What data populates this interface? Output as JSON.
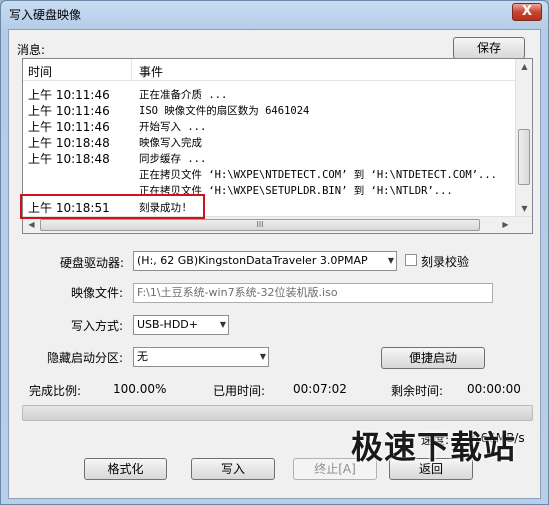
{
  "window": {
    "title": "写入硬盘映像",
    "close": "X"
  },
  "message_label": "消息:",
  "save_button": "保存",
  "log": {
    "columns": [
      "时间",
      "事件"
    ],
    "rows": [
      {
        "time": "上午  10:11:46",
        "event": "正在准备介质 ..."
      },
      {
        "time": "上午  10:11:46",
        "event": "ISO 映像文件的扇区数为 6461024"
      },
      {
        "time": "上午  10:11:46",
        "event": "开始写入 ..."
      },
      {
        "time": "上午  10:18:48",
        "event": "映像写入完成"
      },
      {
        "time": "上午  10:18:48",
        "event": "同步缓存 ..."
      },
      {
        "time": "",
        "event": "正在拷贝文件 ‘H:\\WXPE\\NTDETECT.COM’ 到 ‘H:\\NTDETECT.COM’..."
      },
      {
        "time": "",
        "event": "正在拷贝文件 ‘H:\\WXPE\\SETUPLDR.BIN’ 到 ‘H:\\NTLDR’..."
      },
      {
        "time": "上午  10:18:51",
        "event": "刻录成功!"
      }
    ],
    "hscroll_grip": "III"
  },
  "drive": {
    "label": "硬盘驱动器:",
    "value": "(H:, 62 GB)KingstonDataTraveler 3.0PMAP"
  },
  "verify": {
    "label": "刻录校验",
    "checked": false
  },
  "image_file": {
    "label": "映像文件:",
    "value": "F:\\1\\土豆系统-win7系统-32位装机版.iso"
  },
  "write_mode": {
    "label": "写入方式:",
    "value": "USB-HDD+"
  },
  "hidden_partition": {
    "label": "隐藏启动分区:",
    "value": "无"
  },
  "quick_boot_button": "便捷启动",
  "stats": {
    "percent_label": "完成比例:",
    "percent_value": "100.00%",
    "elapsed_label": "已用时间:",
    "elapsed_value": "00:07:02",
    "remaining_label": "剩余时间:",
    "remaining_value": "00:00:00",
    "speed_label": "速度:",
    "speed_value": "7.66MB/s"
  },
  "buttons": {
    "format": "格式化",
    "write": "写入",
    "stop": "终止[A]",
    "back": "返回"
  },
  "watermark": "极速下载站"
}
